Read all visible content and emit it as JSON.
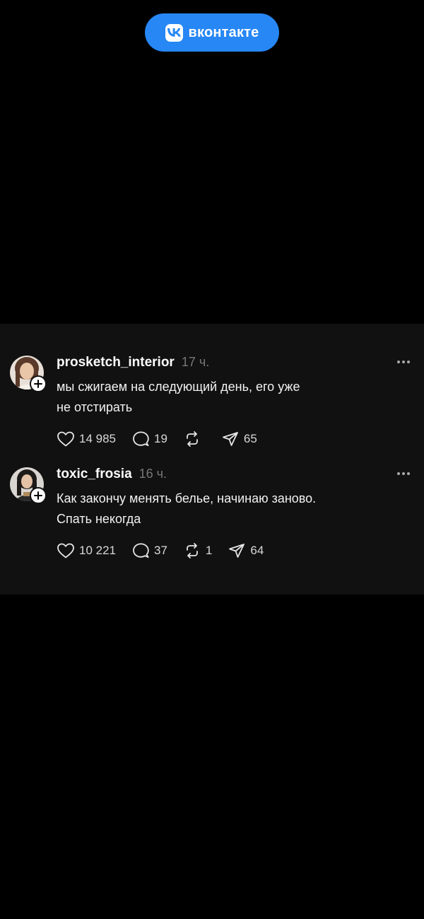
{
  "brand": {
    "name": "вконтакте",
    "logo_icon": "vk-logo-icon",
    "color": "#2787f5"
  },
  "posts": [
    {
      "username": "prosketch_interior",
      "time": "17 ч.",
      "text_lines": [
        "мы сжигаем на следующий день, его уже",
        "не отстирать"
      ],
      "likes": "14 985",
      "replies": "19",
      "reposts": "",
      "shares": "65"
    },
    {
      "username": "toxic_frosia",
      "time": "16 ч.",
      "text_lines": [
        "Как закончу менять белье, начинаю заново.",
        "Спать некогда"
      ],
      "likes": "10 221",
      "replies": "37",
      "reposts": "1",
      "shares": "64"
    }
  ],
  "colors": {
    "background": "#000000",
    "card": "#111111",
    "muted_text": "#777777"
  }
}
